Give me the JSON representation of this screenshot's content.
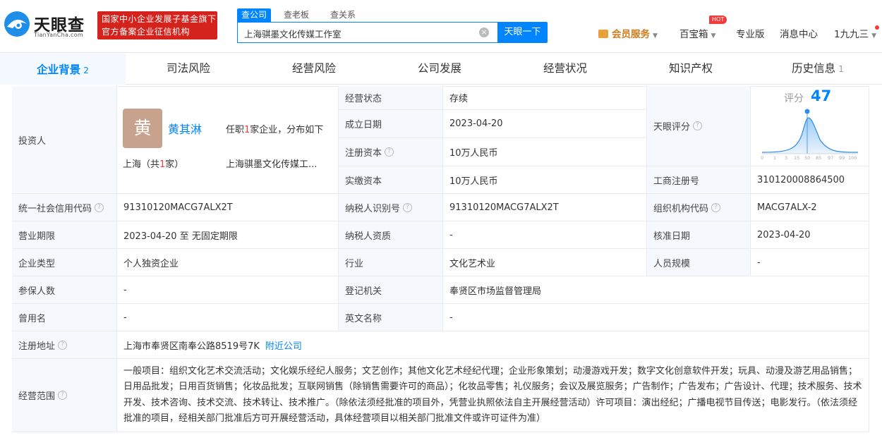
{
  "brand": {
    "name": "天眼查",
    "domain": "TianYanCha.com"
  },
  "badge": {
    "line1": "国家中小企业发展子基金旗下",
    "line2": "官方备案企业征信机构"
  },
  "search": {
    "tabs": [
      "查公司",
      "查老板",
      "查关系"
    ],
    "value": "上海骐墨文化传媒工作室",
    "button": "天眼一下"
  },
  "topnav": {
    "vip": "会员服务",
    "baibao": "百宝箱",
    "hot": "HOT",
    "pro": "专业版",
    "messages": "消息中心",
    "user": "1九九三"
  },
  "tabs": [
    {
      "label": "企业背景",
      "count": "2"
    },
    {
      "label": "司法风险",
      "count": ""
    },
    {
      "label": "经营风险",
      "count": ""
    },
    {
      "label": "公司发展",
      "count": ""
    },
    {
      "label": "经营状况",
      "count": ""
    },
    {
      "label": "知识产权",
      "count": ""
    },
    {
      "label": "历史信息",
      "count": "1"
    }
  ],
  "investor": {
    "label": "投资人",
    "avatar_char": "黄",
    "name": "黄其淋",
    "summary_pre": "任职",
    "summary_num": "1",
    "summary_post": "家企业，分布如下",
    "region_pre": "上海（共",
    "region_num": "1",
    "region_post": "家）",
    "company": "上海骐墨文化传媒工..."
  },
  "score": {
    "label": "天眼评分",
    "title": "评分",
    "value": "47",
    "ticks": [
      "0",
      "1",
      "3",
      "15",
      "50",
      "85",
      "97",
      "99",
      "100"
    ]
  },
  "fields": {
    "status_l": "经营状态",
    "status_v": "存续",
    "founded_l": "成立日期",
    "founded_v": "2023-04-20",
    "regcap_l": "注册资本",
    "regcap_v": "10万人民币",
    "paidcap_l": "实缴资本",
    "paidcap_v": "10万人民币",
    "bizreg_l": "工商注册号",
    "bizreg_v": "310120008864500",
    "credit_l": "统一社会信用代码",
    "credit_v": "91310120MACG7ALX2T",
    "taxid_l": "纳税人识别号",
    "taxid_v": "91310120MACG7ALX2T",
    "orgcode_l": "组织机构代码",
    "orgcode_v": "MACG7ALX-2",
    "term_l": "营业期限",
    "term_v": "2023-04-20 至 无固定期限",
    "taxq_l": "纳税人资质",
    "taxq_v": "-",
    "approve_l": "核准日期",
    "approve_v": "2023-04-20",
    "type_l": "企业类型",
    "type_v": "个人独资企业",
    "industry_l": "行业",
    "industry_v": "文化艺术业",
    "staff_l": "人员规模",
    "staff_v": "-",
    "insured_l": "参保人数",
    "insured_v": "-",
    "authority_l": "登记机关",
    "authority_v": "奉贤区市场监督管理局",
    "formername_l": "曾用名",
    "formername_v": "-",
    "english_l": "英文名称",
    "english_v": "-",
    "address_l": "注册地址",
    "address_v": "上海市奉贤区南奉公路8519号7K",
    "address_link": "附近公司",
    "scope_l": "经营范围",
    "scope_v": "一般项目：组织文化艺术交流活动；文化娱乐经纪人服务；文艺创作；其他文化艺术经纪代理；企业形象策划；动漫游戏开发；数字文化创意软件开发；玩具、动漫及游艺用品销售；日用品批发；日用百货销售；化妆品批发；互联网销售（除销售需要许可的商品）；化妆品零售；礼仪服务；会议及展览服务；广告制作；广告发布；广告设计、代理；技术服务、技术开发、技术咨询、技术交流、技术转让、技术推广。（除依法须经批准的项目外，凭营业执照依法自主开展经营活动）许可项目：演出经纪；广播电视节目传送；电影发行。（依法须经批准的项目，经相关部门批准后方可开展经营活动，具体经营项目以相关部门批准文件或许可证件为准）"
  },
  "colors": {
    "accent": "#0084ff",
    "badge": "#d4231c",
    "label_bg": "#f5f8fc"
  }
}
